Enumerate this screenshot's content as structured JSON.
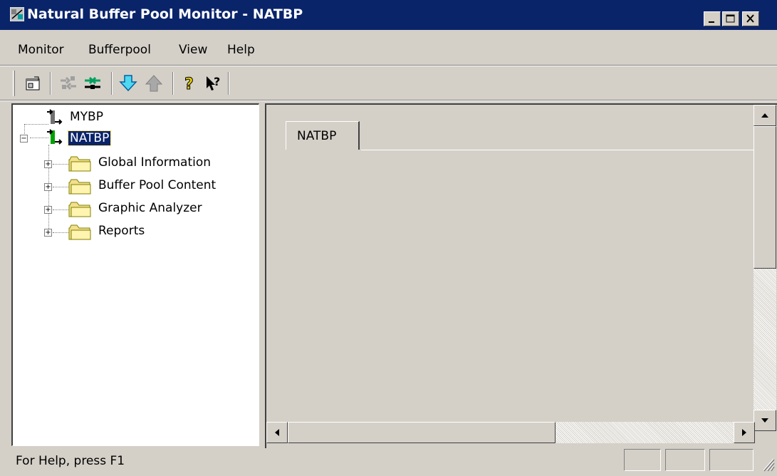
{
  "window": {
    "title": "Natural Buffer Pool Monitor - NATBP",
    "controls": {
      "minimize_icon": "minimize-icon",
      "maximize_icon": "maximize-icon",
      "close_icon": "close-icon"
    }
  },
  "menu": {
    "items": [
      "Monitor",
      "Bufferpool",
      "View",
      "Help"
    ]
  },
  "toolbar": {
    "buttons": [
      "properties-icon",
      "disconnect-icon",
      "connect-icon",
      "move-down-icon",
      "move-up-icon",
      "help-icon",
      "context-help-icon"
    ]
  },
  "tree": {
    "nodes": [
      {
        "label": "MYBP",
        "icon": "bufferpool-icon",
        "selected": false
      },
      {
        "label": "NATBP",
        "icon": "bufferpool-active-icon",
        "selected": true,
        "children": [
          {
            "label": "Global Information",
            "icon": "folder-icon"
          },
          {
            "label": "Buffer Pool Content",
            "icon": "folder-icon"
          },
          {
            "label": "Graphic Analyzer",
            "icon": "folder-icon"
          },
          {
            "label": "Reports",
            "icon": "folder-icon"
          }
        ]
      }
    ]
  },
  "content": {
    "tabs": [
      {
        "label": "NATBP",
        "active": true
      }
    ]
  },
  "statusbar": {
    "text": "For Help, press F1"
  },
  "colors": {
    "titlebar": "#0a246a",
    "face": "#d4d0c8",
    "selection": "#0a246a",
    "folder": "#f2e08c",
    "active_node": "#00a000",
    "toolbar_green": "#00a060",
    "toolbar_cyan": "#00b0d0"
  }
}
